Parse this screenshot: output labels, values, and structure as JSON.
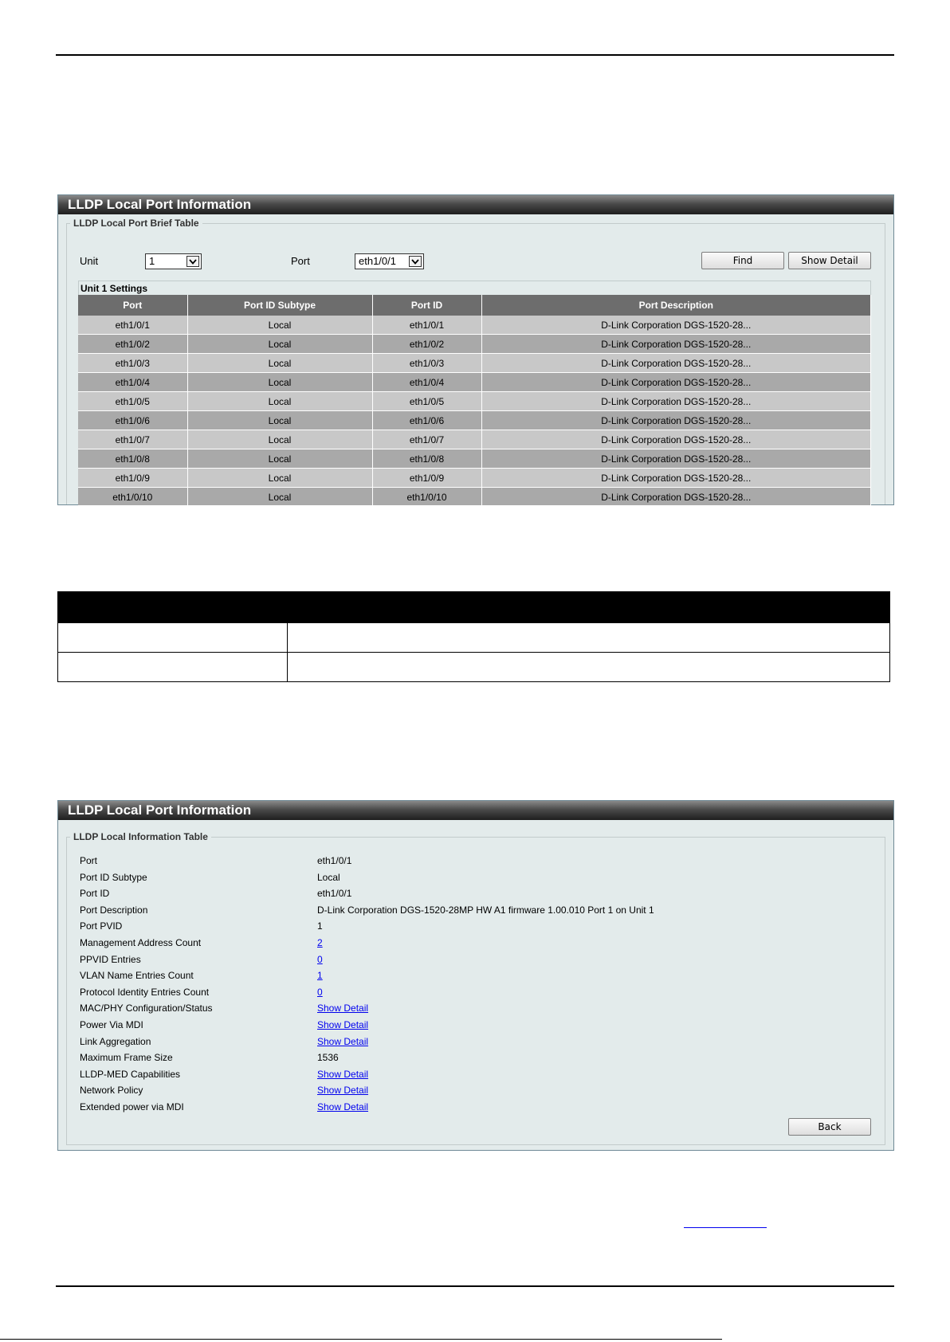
{
  "panel1": {
    "title": "LLDP Local Port Information",
    "legend": "LLDP Local Port Brief Table",
    "unit_label": "Unit",
    "unit_value": "1",
    "port_label": "Port",
    "port_value": "eth1/0/1",
    "find_label": "Find",
    "show_detail_label": "Show Detail",
    "settings_title": "Unit 1 Settings",
    "columns": [
      "Port",
      "Port ID Subtype",
      "Port ID",
      "Port Description"
    ],
    "rows": [
      [
        "eth1/0/1",
        "Local",
        "eth1/0/1",
        "D-Link Corporation DGS-1520-28..."
      ],
      [
        "eth1/0/2",
        "Local",
        "eth1/0/2",
        "D-Link Corporation DGS-1520-28..."
      ],
      [
        "eth1/0/3",
        "Local",
        "eth1/0/3",
        "D-Link Corporation DGS-1520-28..."
      ],
      [
        "eth1/0/4",
        "Local",
        "eth1/0/4",
        "D-Link Corporation DGS-1520-28..."
      ],
      [
        "eth1/0/5",
        "Local",
        "eth1/0/5",
        "D-Link Corporation DGS-1520-28..."
      ],
      [
        "eth1/0/6",
        "Local",
        "eth1/0/6",
        "D-Link Corporation DGS-1520-28..."
      ],
      [
        "eth1/0/7",
        "Local",
        "eth1/0/7",
        "D-Link Corporation DGS-1520-28..."
      ],
      [
        "eth1/0/8",
        "Local",
        "eth1/0/8",
        "D-Link Corporation DGS-1520-28..."
      ],
      [
        "eth1/0/9",
        "Local",
        "eth1/0/9",
        "D-Link Corporation DGS-1520-28..."
      ],
      [
        "eth1/0/10",
        "Local",
        "eth1/0/10",
        "D-Link Corporation DGS-1520-28..."
      ]
    ]
  },
  "panel2": {
    "title": "LLDP Local Port Information",
    "legend": "LLDP Local Information Table",
    "back_label": "Back",
    "items": [
      {
        "label": "Port",
        "value": "eth1/0/1",
        "link": false
      },
      {
        "label": "Port ID Subtype",
        "value": "Local",
        "link": false
      },
      {
        "label": "Port ID",
        "value": "eth1/0/1",
        "link": false
      },
      {
        "label": "Port Description",
        "value": "D-Link Corporation DGS-1520-28MP HW A1 firmware 1.00.010 Port 1 on Unit 1",
        "link": false
      },
      {
        "label": "Port PVID",
        "value": "1",
        "link": false
      },
      {
        "label": "Management Address Count",
        "value": "2",
        "link": true
      },
      {
        "label": "PPVID Entries",
        "value": "0",
        "link": true
      },
      {
        "label": "VLAN Name Entries Count",
        "value": "1",
        "link": true
      },
      {
        "label": "Protocol Identity Entries Count",
        "value": "0",
        "link": true
      },
      {
        "label": "MAC/PHY Configuration/Status",
        "value": "Show Detail",
        "link": true
      },
      {
        "label": "Power Via MDI",
        "value": "Show Detail",
        "link": true
      },
      {
        "label": "Link Aggregation",
        "value": "Show Detail",
        "link": true
      },
      {
        "label": "Maximum Frame Size",
        "value": "1536",
        "link": false
      },
      {
        "label": "LLDP-MED Capabilities",
        "value": "Show Detail",
        "link": true
      },
      {
        "label": "Network Policy",
        "value": "Show Detail",
        "link": true
      },
      {
        "label": "Extended power via MDI",
        "value": "Show Detail",
        "link": true
      }
    ]
  },
  "icons": {
    "dropdown": "chevron-down-icon"
  }
}
